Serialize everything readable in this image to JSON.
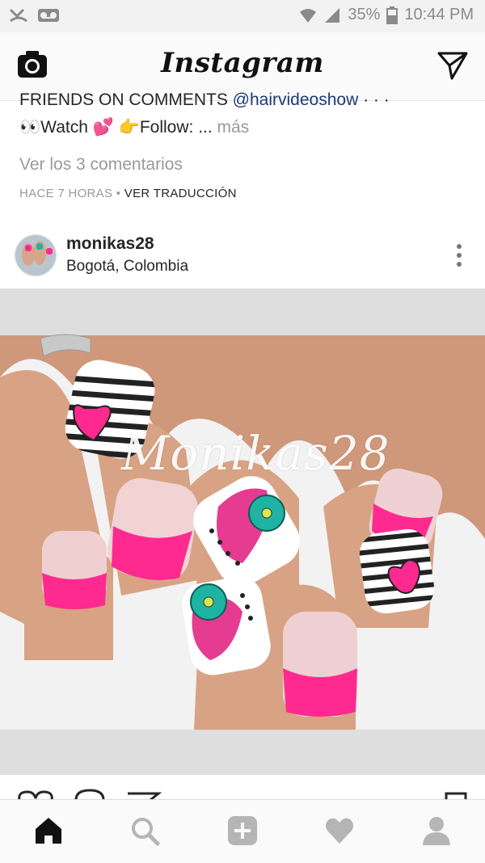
{
  "status_bar": {
    "battery_percent": "35%",
    "time": "10:44 PM"
  },
  "app_bar": {
    "title": "Instagram"
  },
  "caption": {
    "line1_text": "FRIENDS ON COMMENTS ",
    "mention": "@hairvideoshow",
    "line1_suffix": " · · ·",
    "line2_text": "👀Watch 💕 👉Follow: ... ",
    "more_label": "más"
  },
  "view_comments": "Ver los 3 comentarios",
  "meta": {
    "time_ago": "HACE 7 HORAS",
    "separator": " • ",
    "translate_label": "VER TRADUCCIÓN"
  },
  "post": {
    "username": "monikas28",
    "location": "Bogotá, Colombia",
    "watermark": "Monikas28"
  },
  "bottom_nav": {
    "items": [
      "home",
      "search",
      "add",
      "activity",
      "profile"
    ]
  },
  "colors": {
    "nail_pink": "#ff2a8f",
    "nail_teal": "#1fb3a3",
    "skin": "#d8a384"
  }
}
